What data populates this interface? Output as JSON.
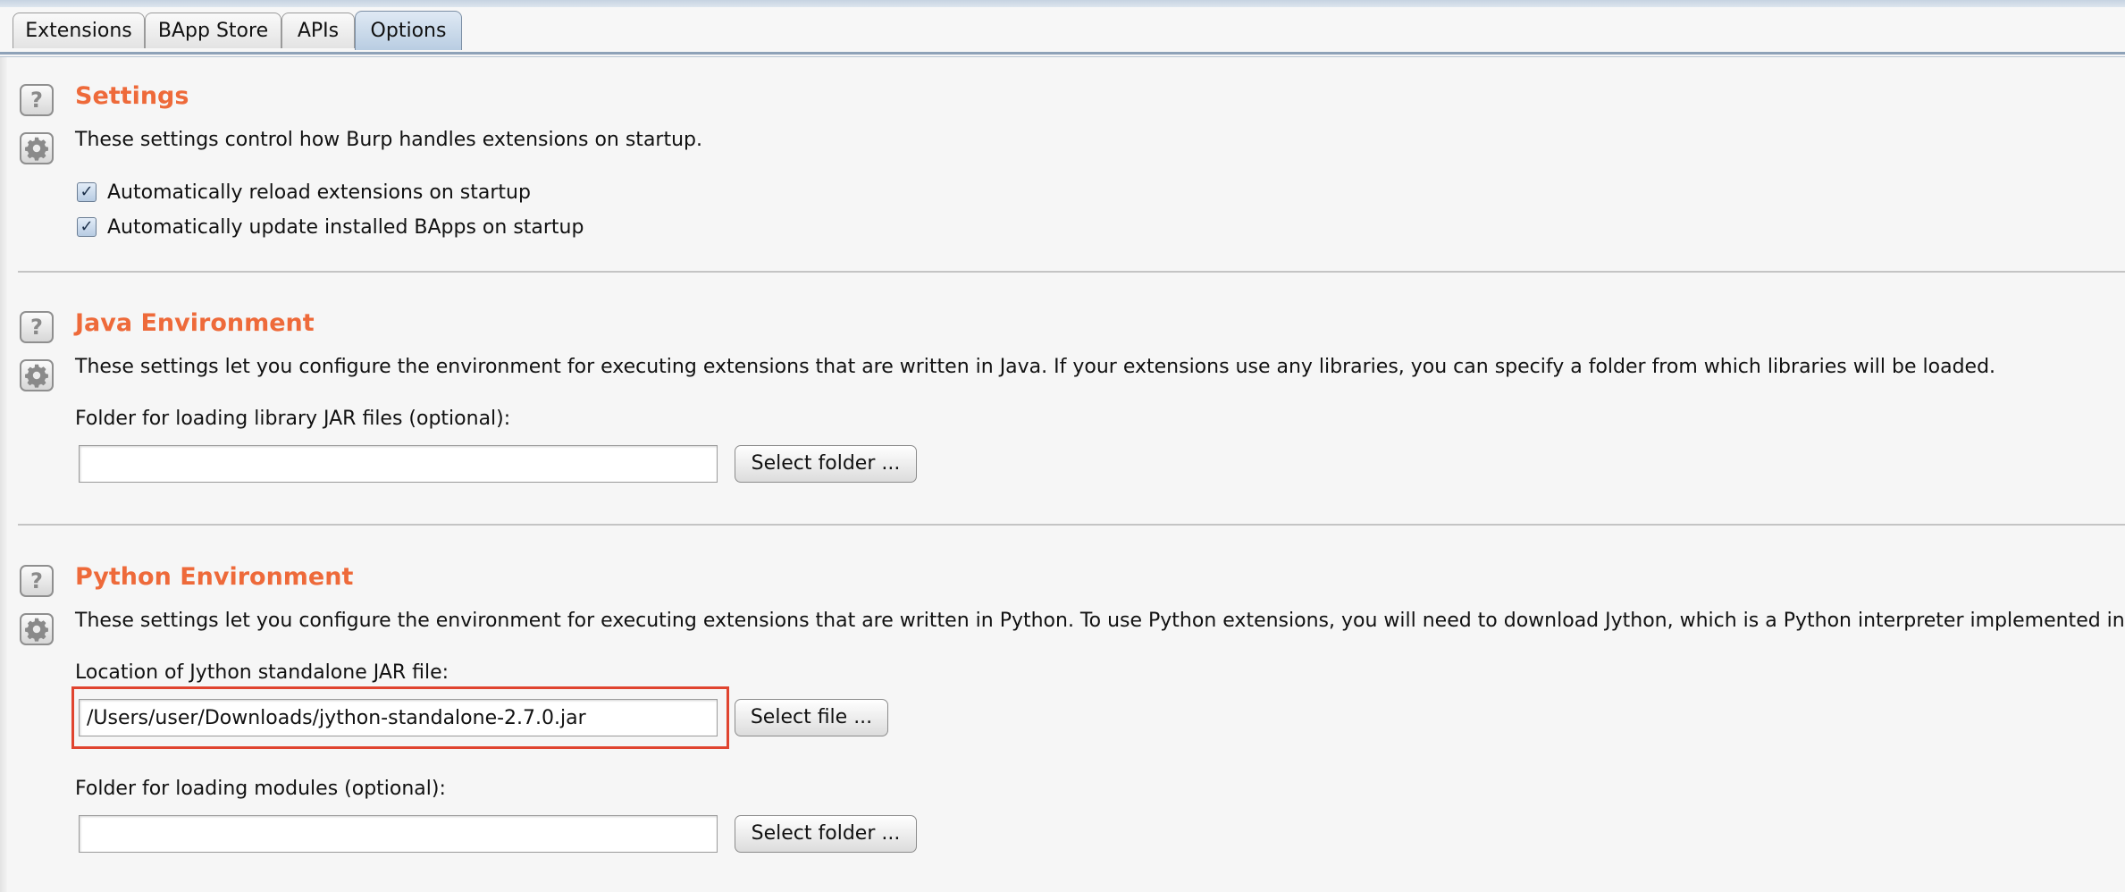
{
  "tabs": [
    {
      "label": "Extensions",
      "active": false
    },
    {
      "label": "BApp Store",
      "active": false
    },
    {
      "label": "APIs",
      "active": false
    },
    {
      "label": "Options",
      "active": true
    }
  ],
  "sections": {
    "settings": {
      "title": "Settings",
      "description": "These settings control how Burp handles extensions on startup.",
      "options": [
        {
          "label": "Automatically reload extensions on startup",
          "checked": true
        },
        {
          "label": "Automatically update installed BApps on startup",
          "checked": true
        }
      ]
    },
    "java": {
      "title": "Java Environment",
      "description": "These settings let you configure the environment for executing extensions that are written in Java. If your extensions use any libraries, you can specify a folder from which libraries will be loaded.",
      "folder_label": "Folder for loading library JAR files (optional):",
      "folder_value": "",
      "select_button": "Select folder ..."
    },
    "python": {
      "title": "Python Environment",
      "description": "These settings let you configure the environment for executing extensions that are written in Python. To use Python extensions, you will need to download Jython, which is a Python interpreter implemented in Java.",
      "jar_label": "Location of Jython standalone JAR file:",
      "jar_value": "/Users/user/Downloads/jython-standalone-2.7.0.jar",
      "select_file_button": "Select file ...",
      "modules_label": "Folder for loading modules (optional):",
      "modules_value": "",
      "select_folder_button": "Select folder ..."
    }
  },
  "icons": {
    "help": "help-icon",
    "settings": "gear-icon",
    "check_glyph": "✓"
  },
  "colors": {
    "heading": "#ee6a3a",
    "highlight": "#e0442f",
    "active_tab": "#b9cde2"
  }
}
